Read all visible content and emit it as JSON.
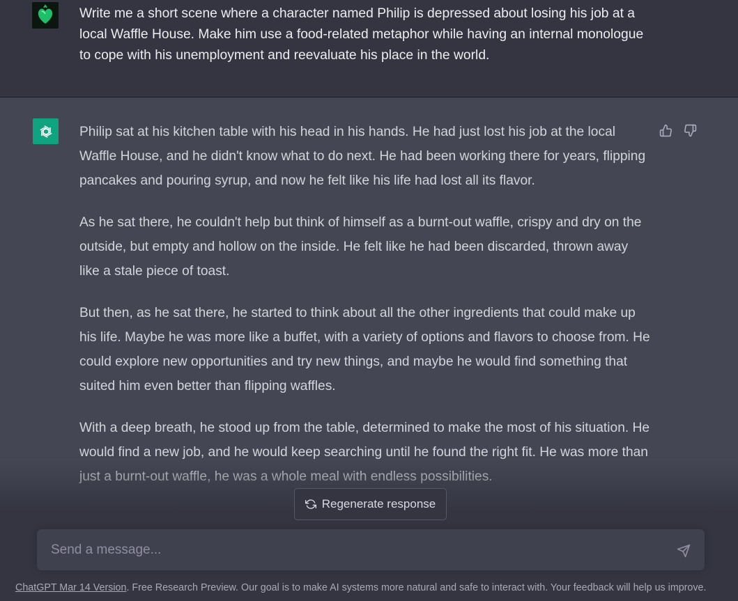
{
  "user_message": {
    "avatar": "green-heart-image",
    "text": "Write me a short scene where a character named Philip is depressed about losing his job at a local Waffle House. Make him use a food-related metaphor while having an internal monologue to cope with his unemployment and reevaluate his place in the world."
  },
  "assistant_message": {
    "avatar": "openai-logo-icon",
    "paragraphs": [
      "Philip sat at his kitchen table with his head in his hands. He had just lost his job at the local Waffle House, and he didn't know what to do next. He had been working there for years, flipping pancakes and pouring syrup, and now he felt like his life had lost all its flavor.",
      "As he sat there, he couldn't help but think of himself as a burnt-out waffle, crispy and dry on the outside, but empty and hollow on the inside. He felt like he had been discarded, thrown away like a stale piece of toast.",
      "But then, as he sat there, he started to think about all the other ingredients that could make up his life. Maybe he was more like a buffet, with a variety of options and flavors to choose from. He could explore new opportunities and try new things, and maybe he would find something that suited him even better than flipping waffles.",
      "With a deep breath, he stood up from the table, determined to make the most of his situation. He would find a new job, and he would keep searching until he found the right fit. He was more than just a burnt-out waffle, he was a whole meal with endless possibilities."
    ],
    "feedback_icons": [
      "thumbs-up-icon",
      "thumbs-down-icon"
    ]
  },
  "regenerate": {
    "label": "Regenerate response",
    "icon": "refresh-icon"
  },
  "composer": {
    "placeholder": "Send a message...",
    "send_icon": "paper-plane-icon"
  },
  "footer": {
    "version_link": "ChatGPT Mar 14 Version",
    "text": ". Free Research Preview. Our goal is to make AI systems more natural and safe to interact with. Your feedback will help us improve."
  },
  "colors": {
    "background": "#343541",
    "assistant_background": "#444654",
    "accent": "#10a37f",
    "input_background": "#40414f"
  }
}
